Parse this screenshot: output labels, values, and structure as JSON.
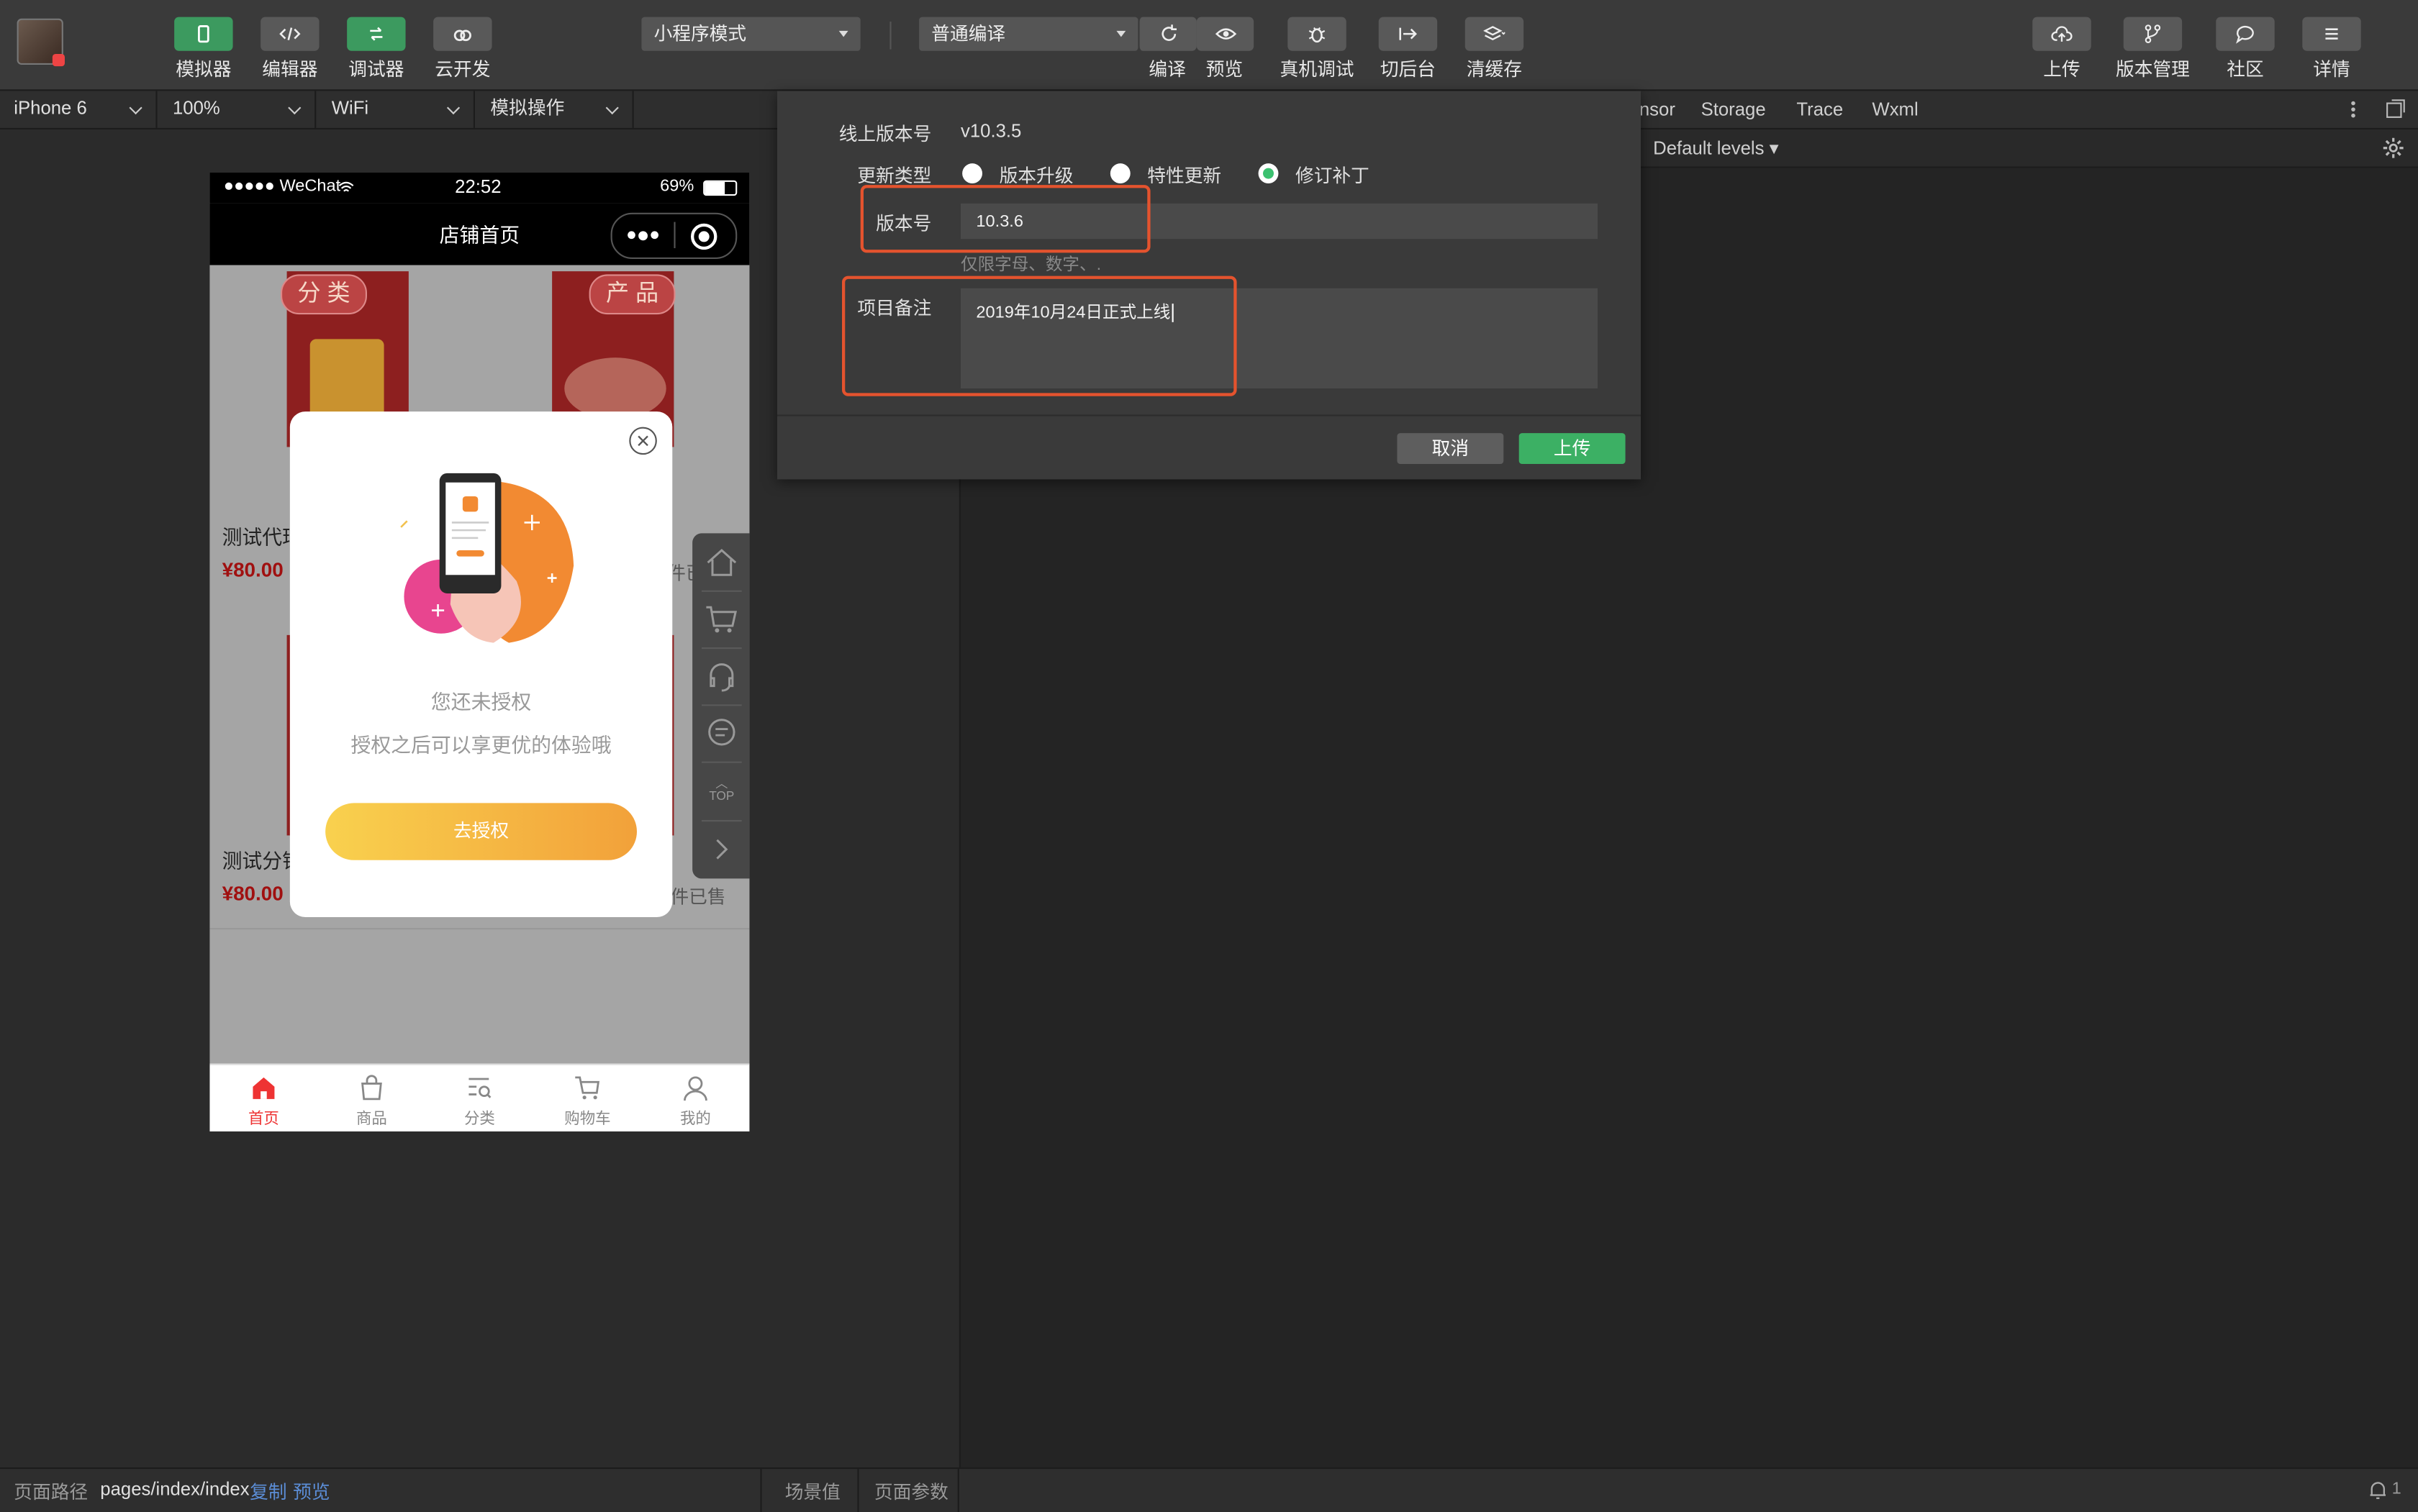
{
  "toolbar": {
    "left_buttons": [
      {
        "label": "模拟器",
        "icon": "phone-icon"
      },
      {
        "label": "编辑器",
        "icon": "code-icon"
      },
      {
        "label": "调试器",
        "icon": "debug-toggle-icon"
      },
      {
        "label": "云开发",
        "icon": "cloud-link-icon"
      }
    ],
    "mode_select": "小程序模式",
    "compile_select": "普通编译",
    "center_buttons": [
      {
        "label": "编译",
        "icon": "refresh-icon"
      },
      {
        "label": "预览",
        "icon": "eye-icon"
      },
      {
        "label": "真机调试",
        "icon": "bug-icon"
      },
      {
        "label": "切后台",
        "icon": "switch-background-icon"
      },
      {
        "label": "清缓存",
        "icon": "layers-icon"
      }
    ],
    "right_buttons": [
      {
        "label": "上传",
        "icon": "cloud-upload-icon"
      },
      {
        "label": "版本管理",
        "icon": "branch-icon"
      },
      {
        "label": "社区",
        "icon": "chat-bubble-icon"
      },
      {
        "label": "详情",
        "icon": "menu-icon"
      }
    ]
  },
  "subbar": {
    "device": "iPhone 6",
    "zoom": "100%",
    "network": "WiFi",
    "operation": "模拟操作"
  },
  "phone": {
    "status": {
      "carrier": "●●●●● WeChat",
      "time": "22:52",
      "battery": "69%"
    },
    "nav_title": "店铺首页",
    "cards": [
      {
        "badge": "分 类",
        "title": "测试代玛",
        "price": "¥80.00"
      },
      {
        "badge": "产 品",
        "title": "",
        "price": "",
        "sold": "5件已"
      },
      {
        "title": "测试分销",
        "price": "¥80.00"
      },
      {
        "sold": "8件已售"
      }
    ],
    "modal": {
      "title": "您还未授权",
      "subtitle": "授权之后可以享更优的体验哦",
      "button": "去授权"
    },
    "float_top_label": "TOP",
    "tabs": [
      {
        "label": "首页",
        "icon": "home-icon",
        "active": true
      },
      {
        "label": "商品",
        "icon": "bag-icon",
        "active": false
      },
      {
        "label": "分类",
        "icon": "category-search-icon",
        "active": false
      },
      {
        "label": "购物车",
        "icon": "cart-icon",
        "active": false
      },
      {
        "label": "我的",
        "icon": "user-icon",
        "active": false
      }
    ]
  },
  "upload_dialog": {
    "online_version_label": "线上版本号",
    "online_version_value": "v10.3.5",
    "update_type_label": "更新类型",
    "update_types": [
      {
        "label": "版本升级",
        "checked": false
      },
      {
        "label": "特性更新",
        "checked": false
      },
      {
        "label": "修订补丁",
        "checked": true
      }
    ],
    "version_label": "版本号",
    "version_value": "10.3.6",
    "version_hint": "仅限字母、数字、.",
    "remark_label": "项目备注",
    "remark_value": "2019年10月24日正式上线",
    "cancel": "取消",
    "upload": "上传",
    "highlight_color": "#e4532e",
    "accent_color": "#3cc170"
  },
  "devtools": {
    "tabs": [
      "nsor",
      "Storage",
      "Trace",
      "Wxml"
    ],
    "levels": "Default levels"
  },
  "bottombar": {
    "path_label": "页面路径",
    "path_value": "pages/index/index",
    "copy": "复制",
    "preview": "预览",
    "scene": "场景值",
    "params": "页面参数",
    "notif_count": "1"
  }
}
